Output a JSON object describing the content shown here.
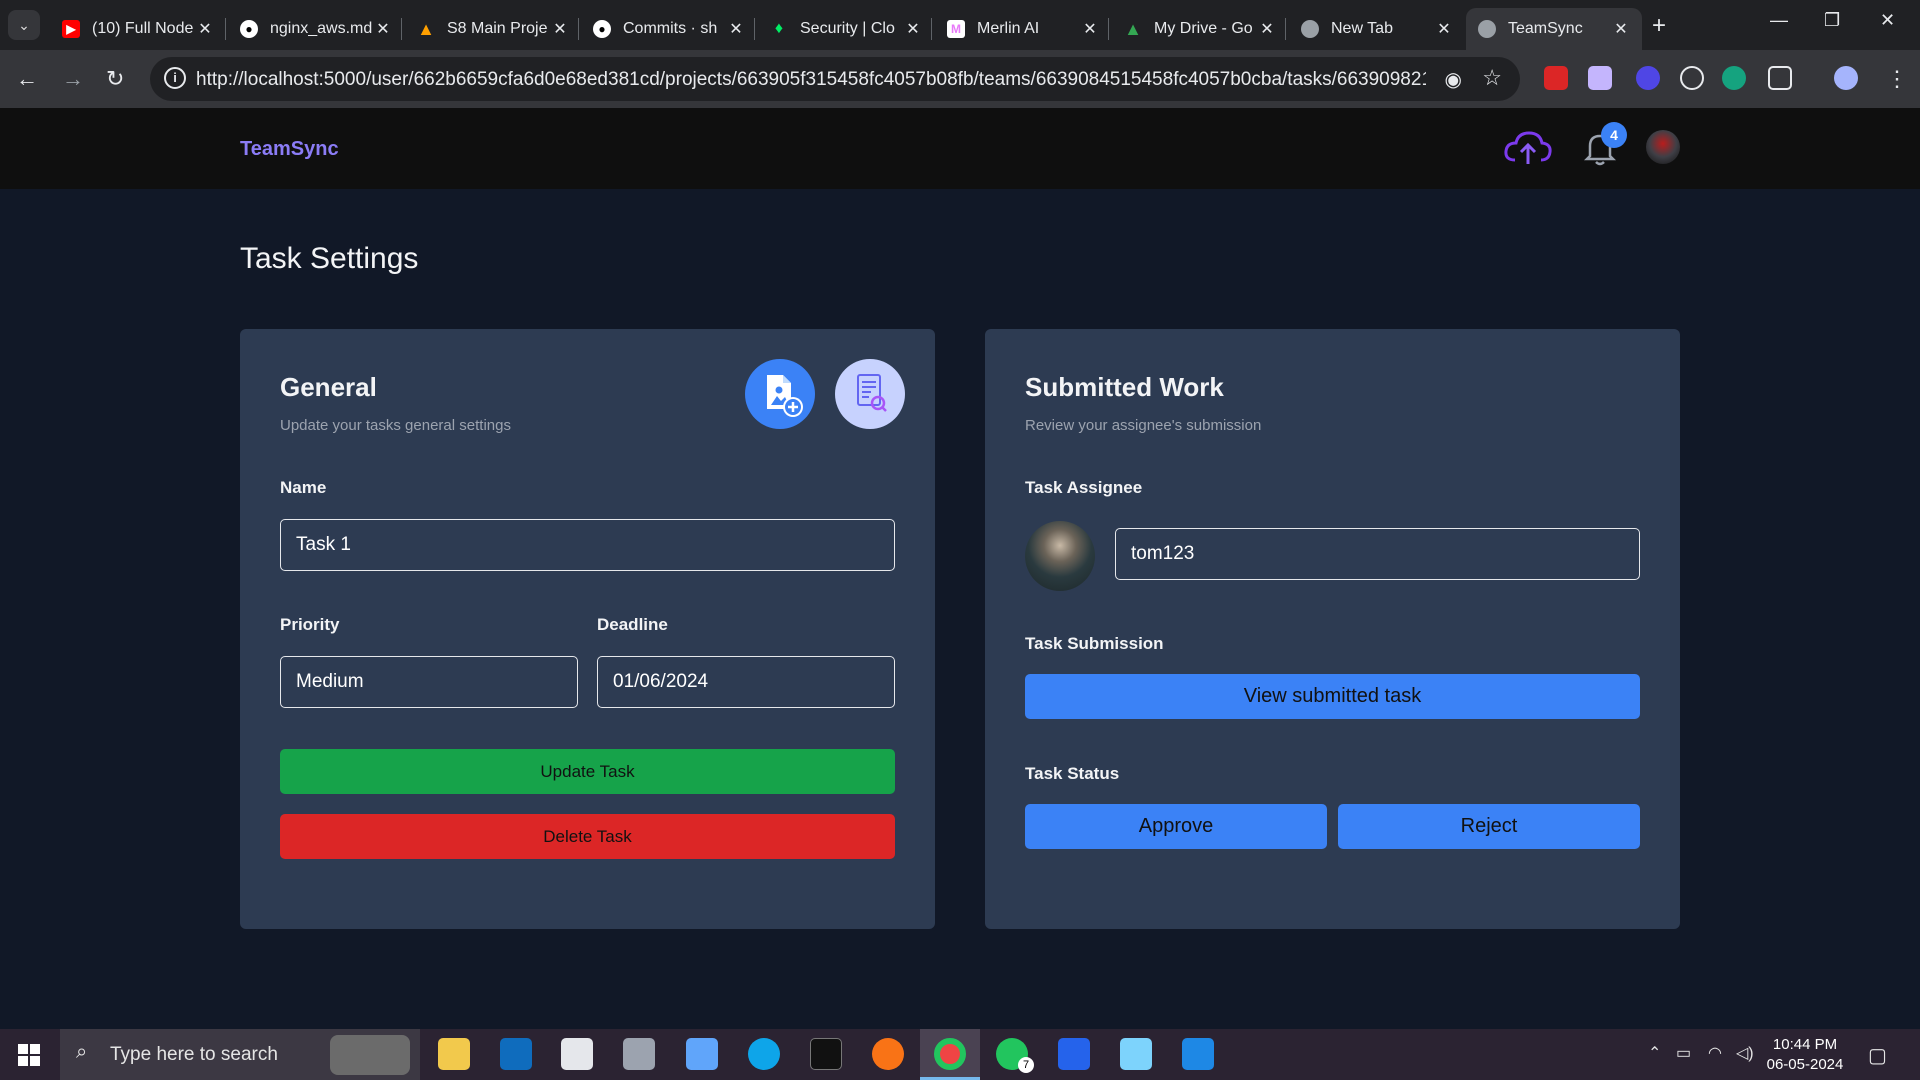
{
  "browser": {
    "tabs": [
      {
        "title": "(10) Full Node",
        "favicon": "youtube-icon",
        "color": "#ff0000"
      },
      {
        "title": "nginx_aws.md",
        "favicon": "github-icon",
        "color": "#ffffff"
      },
      {
        "title": "S8 Main Proje",
        "favicon": "firebase-icon",
        "color": "#ffa000"
      },
      {
        "title": "Commits · sh",
        "favicon": "github-icon",
        "color": "#ffffff"
      },
      {
        "title": "Security | Clo",
        "favicon": "mongodb-icon",
        "color": "#00ed64"
      },
      {
        "title": "Merlin AI",
        "favicon": "merlin-icon",
        "color": "#e879f9"
      },
      {
        "title": "My Drive - Go",
        "favicon": "drive-icon",
        "color": "#34a853"
      },
      {
        "title": "New Tab",
        "favicon": "chrome-icon",
        "color": "#9aa0a6"
      },
      {
        "title": "TeamSync",
        "favicon": "globe-icon",
        "color": "#9aa0a6"
      }
    ],
    "url": "http://localhost:5000/user/662b6659cfa6d0e68ed381cd/projects/663905f315458fc4057b08fb/teams/6639084515458fc4057b0cba/tasks/6639098215458fc405..."
  },
  "app": {
    "brand": "TeamSync",
    "notification_count": "4",
    "page_title": "Task Settings"
  },
  "general": {
    "title": "General",
    "subtitle": "Update your tasks general settings",
    "name_label": "Name",
    "name_value": "Task 1",
    "priority_label": "Priority",
    "priority_value": "Medium",
    "deadline_label": "Deadline",
    "deadline_value": "01/06/2024",
    "update_button": "Update Task",
    "delete_button": "Delete Task"
  },
  "submitted": {
    "title": "Submitted Work",
    "subtitle": "Review your assignee's submission",
    "assignee_label": "Task Assignee",
    "assignee_value": "tom123",
    "submission_label": "Task Submission",
    "view_button": "View submitted task",
    "status_label": "Task Status",
    "approve_button": "Approve",
    "reject_button": "Reject"
  },
  "taskbar": {
    "search_placeholder": "Type here to search",
    "time": "10:44 PM",
    "date": "06-05-2024",
    "whatsapp_badge": "7"
  },
  "colors": {
    "brand": "#8b7cf6",
    "card": "#2d3b52",
    "primary": "#3b82f6",
    "success": "#16a34a",
    "danger": "#dc2626"
  }
}
